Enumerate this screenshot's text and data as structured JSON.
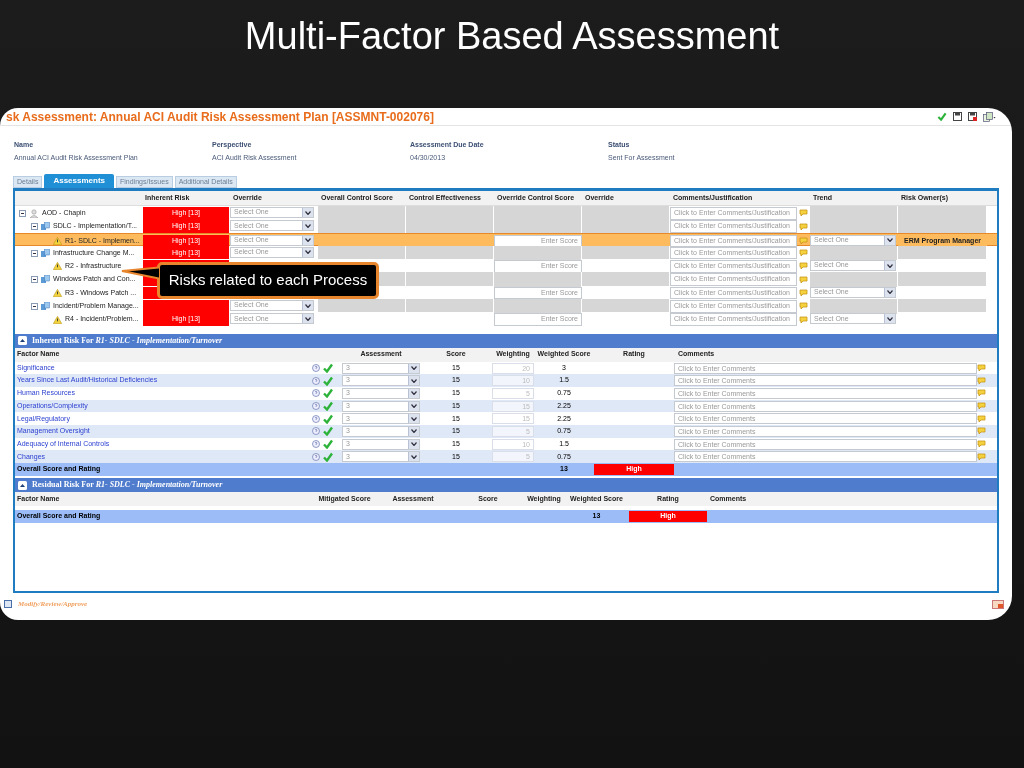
{
  "slide_title": "Multi-Factor Based Assessment",
  "page_title": "sk Assessment: Annual ACI Audit Risk Assessment Plan [ASSMNT-002076]",
  "fields": [
    {
      "label": "Name",
      "value": "Annual ACI Audit Risk Assessment Plan"
    },
    {
      "label": "Perspective",
      "value": "ACI Audit Risk Assessment"
    },
    {
      "label": "Assessment Due Date",
      "value": "04/30/2013"
    },
    {
      "label": "Status",
      "value": "Sent For Assessment"
    }
  ],
  "tabs": [
    {
      "label": "Details",
      "selected": false
    },
    {
      "label": "Assessments",
      "selected": true
    },
    {
      "label": "Findings/Issues",
      "selected": false
    },
    {
      "label": "Additional Details",
      "selected": false
    }
  ],
  "risk_table": {
    "columns": [
      "Inherent Risk",
      "Override",
      "Overall Control Score",
      "Control Effectiveness",
      "Override Control Score",
      "Override",
      "Comments/Justification",
      "Trend",
      "Risk Owner(s)"
    ],
    "tree": [
      {
        "kind": "entity",
        "label": "AOD - Chapin",
        "expanded": true,
        "selected": false,
        "inherent_risk": "High [13]",
        "override": "Select One",
        "comments": "Click to Enter Comments/Justification",
        "children": [
          {
            "kind": "process",
            "label": "SDLC - Implementation/T...",
            "expanded": true,
            "selected": false,
            "inherent_risk": "High [13]",
            "override": "Select One",
            "comments": "Click to Enter Comments/Justification",
            "children": [
              {
                "kind": "risk",
                "label": "R1- SDLC - Implemen...",
                "selected": true,
                "inherent_risk": "High [13]",
                "override": "Select One",
                "override_score": "Enter Score",
                "comments": "Click to Enter Comments/Justification",
                "trend": "Select One",
                "risk_owner": "ERM Program Manager"
              }
            ]
          },
          {
            "kind": "process",
            "label": "Infrastructure Change M...",
            "expanded": true,
            "selected": false,
            "inherent_risk": "High [13]",
            "override": "Select One",
            "comments": "Click to Enter Comments/Justification",
            "children": [
              {
                "kind": "risk",
                "label": "R2 - Infrastructure",
                "selected": false,
                "override_score": "Enter Score",
                "comments": "Click to Enter Comments/Justification",
                "trend": "Select One"
              }
            ]
          },
          {
            "kind": "process",
            "label": "Windows Patch and Con...",
            "expanded": true,
            "selected": false,
            "comments": "Click to Enter Comments/Justification",
            "children": [
              {
                "kind": "risk",
                "label": "R3 - Windows Patch ...",
                "selected": false,
                "override_score": "Enter Score",
                "comments": "Click to Enter Comments/Justification",
                "trend": "Select One"
              }
            ]
          },
          {
            "kind": "process",
            "label": "Incident/Problem Manage...",
            "expanded": true,
            "selected": false,
            "override": "Select One",
            "comments": "Click to Enter Comments/Justification",
            "children": [
              {
                "kind": "risk",
                "label": "R4 - Incident/Problem...",
                "selected": false,
                "inherent_risk": "High [13]",
                "override": "Select One",
                "override_score": "Enter Score",
                "comments": "Click to Enter Comments/Justification",
                "trend": "Select One"
              }
            ]
          }
        ]
      }
    ]
  },
  "callout": "Risks related to each Process",
  "inherent_section": {
    "title": "Inherent Risk For *R1- SDLC - Implementation/Turnover*",
    "expanded": true,
    "columns": [
      "Factor Name",
      "Assessment",
      "Score",
      "Weighting",
      "Weighted Score",
      "Rating",
      "Comments"
    ],
    "factors": [
      {
        "name": "Significance",
        "assessment": "3",
        "score": "15",
        "weighting": "20",
        "weighted_score": "3",
        "comments": "Click to Enter Comments"
      },
      {
        "name": "Years Since Last Audit/Historical Deficiencies",
        "assessment": "3",
        "score": "15",
        "weighting": "10",
        "weighted_score": "1.5",
        "comments": "Click to Enter Comments"
      },
      {
        "name": "Human Resources",
        "assessment": "3",
        "score": "15",
        "weighting": "5",
        "weighted_score": "0.75",
        "comments": "Click to Enter Comments"
      },
      {
        "name": "Operations/Complexity",
        "assessment": "3",
        "score": "15",
        "weighting": "15",
        "weighted_score": "2.25",
        "comments": "Click to Enter Comments"
      },
      {
        "name": "Legal/Regulatory",
        "assessment": "3",
        "score": "15",
        "weighting": "15",
        "weighted_score": "2.25",
        "comments": "Click to Enter Comments"
      },
      {
        "name": "Management Oversight",
        "assessment": "3",
        "score": "15",
        "weighting": "5",
        "weighted_score": "0.75",
        "comments": "Click to Enter Comments"
      },
      {
        "name": "Adequacy of Internal Controls",
        "assessment": "3",
        "score": "15",
        "weighting": "10",
        "weighted_score": "1.5",
        "comments": "Click to Enter Comments"
      },
      {
        "name": "Changes",
        "assessment": "3",
        "score": "15",
        "weighting": "5",
        "weighted_score": "0.75",
        "comments": "Click to Enter Comments"
      }
    ],
    "overall": {
      "label": "Overall Score and Rating",
      "score": "13",
      "rating": "High"
    }
  },
  "residual_section": {
    "title": "Residual Risk For *R1- SDLC - Implementation/Turnover*",
    "expanded": true,
    "columns": [
      "Factor Name",
      "Mitigated Score",
      "Assessment",
      "Score",
      "Weighting",
      "Weighted Score",
      "Rating",
      "Comments"
    ],
    "overall": {
      "label": "Overall Score and Rating",
      "score": "13",
      "rating": "High"
    }
  },
  "footer": {
    "label": "Modify/Review/Approve"
  }
}
